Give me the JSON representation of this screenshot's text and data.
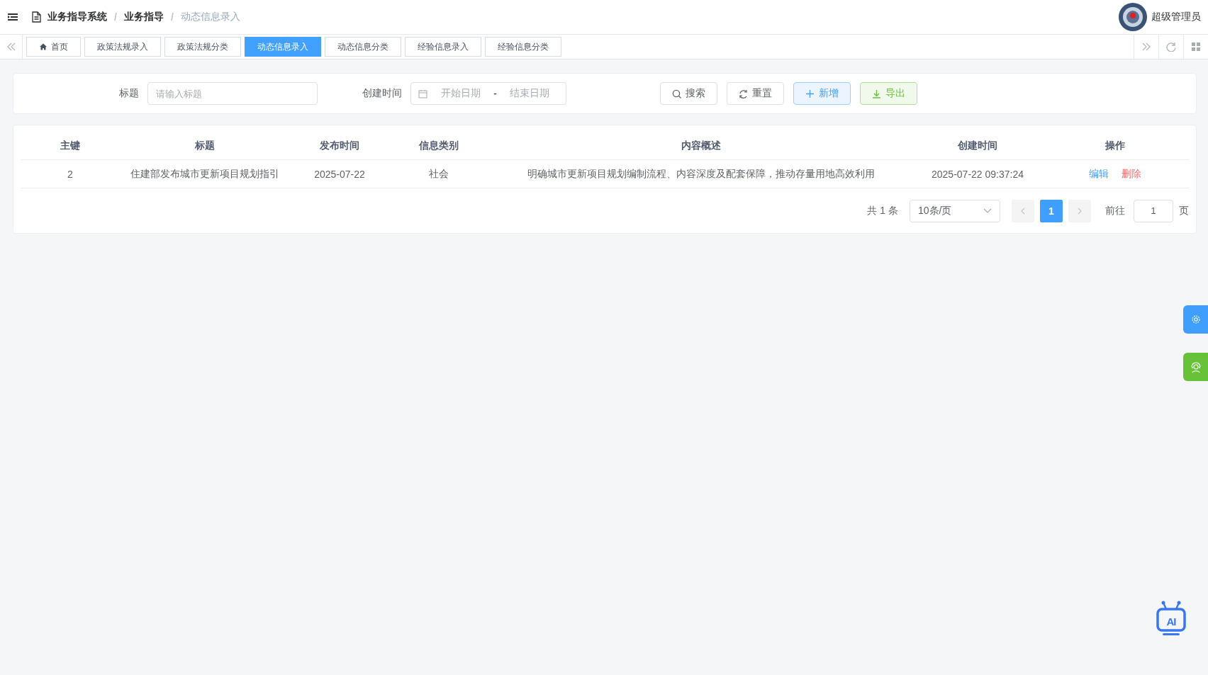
{
  "header": {
    "breadcrumbs": [
      {
        "text": "业务指导系统",
        "current": false
      },
      {
        "text": "业务指导",
        "current": false
      },
      {
        "text": "动态信息录入",
        "current": true
      }
    ],
    "separator": "/",
    "user": "超级管理员"
  },
  "tabs": [
    {
      "label": "首页",
      "kind": "home",
      "selected": false
    },
    {
      "label": "政策法规录入",
      "kind": "page",
      "selected": false
    },
    {
      "label": "政策法规分类",
      "kind": "page",
      "selected": false
    },
    {
      "label": "动态信息录入",
      "kind": "page",
      "selected": true
    },
    {
      "label": "动态信息分类",
      "kind": "page",
      "selected": false
    },
    {
      "label": "经验信息录入",
      "kind": "page",
      "selected": false
    },
    {
      "label": "经验信息分类",
      "kind": "page",
      "selected": false
    }
  ],
  "search": {
    "fields": [
      {
        "label": "标题",
        "kind": "text",
        "placeholder": "请输入标题"
      },
      {
        "label": "创建时间",
        "kind": "daterange",
        "start_placeholder": "开始日期",
        "separator": "-",
        "end_placeholder": "结束日期"
      }
    ],
    "buttons": [
      {
        "label": "搜索",
        "kind": "search"
      },
      {
        "label": "重置",
        "kind": "reset"
      },
      {
        "label": "新增",
        "kind": "add"
      },
      {
        "label": "导出",
        "kind": "export"
      }
    ]
  },
  "table": {
    "columns": [
      "主键",
      "标题",
      "发布时间",
      "信息类别",
      "内容概述",
      "创建时间",
      "操作"
    ],
    "rows": [
      {
        "cells": [
          "2",
          "住建部发布城市更新项目规划指引",
          "2025-07-22",
          "社会",
          "明确城市更新项目规划编制流程、内容深度及配套保障，推动存量用地高效利用",
          "2025-07-22 09:37:24"
        ],
        "actions": [
          {
            "label": "编辑",
            "kind": "edit"
          },
          {
            "label": "删除",
            "kind": "delete"
          }
        ]
      }
    ]
  },
  "pagination": {
    "total": "共 1 条",
    "page_size": "10条/页",
    "pages": [
      {
        "label": "1",
        "selected": true
      }
    ],
    "goto_label": "前往",
    "goto_value": "1",
    "page_suffix": "页"
  },
  "ai_badge": "AI"
}
